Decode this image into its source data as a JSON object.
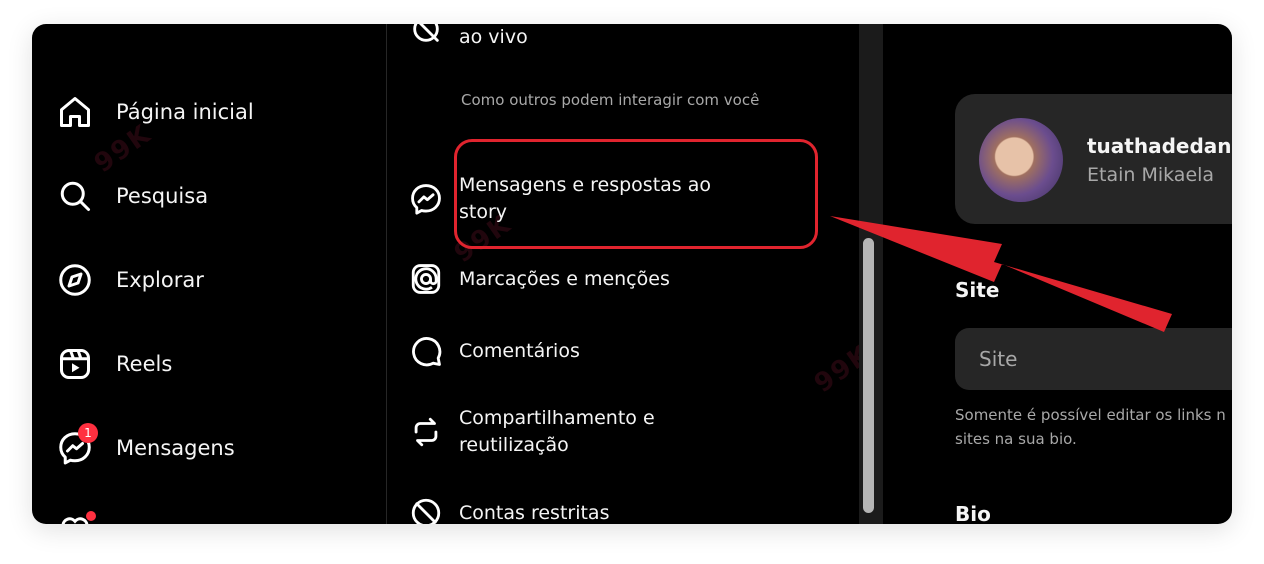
{
  "sidebar": {
    "items": [
      {
        "label": "Página inicial",
        "icon": "home-icon"
      },
      {
        "label": "Pesquisa",
        "icon": "search-icon"
      },
      {
        "label": "Explorar",
        "icon": "compass-icon"
      },
      {
        "label": "Reels",
        "icon": "reels-icon"
      },
      {
        "label": "Mensagens",
        "icon": "messenger-icon",
        "badge": "1"
      }
    ]
  },
  "settings": {
    "top_item": "ao vivo",
    "section_label": "Como outros podem interagir com você",
    "items": [
      {
        "label": "Mensagens e respostas ao story",
        "icon": "messenger-icon",
        "highlighted": true
      },
      {
        "label": "Marcações e menções",
        "icon": "at-icon"
      },
      {
        "label": "Comentários",
        "icon": "comment-icon"
      },
      {
        "label": "Compartilhamento e reutilização",
        "icon": "repost-icon"
      },
      {
        "label": "Contas restritas",
        "icon": "restricted-icon"
      }
    ]
  },
  "profile": {
    "username": "tuathadedan",
    "full_name": "Etain Mikaela"
  },
  "form": {
    "site_label": "Site",
    "site_placeholder": "Site",
    "site_helper": "Somente é possível editar os links n sites na sua bio.",
    "bio_label": "Bio"
  },
  "colors": {
    "background": "#000000",
    "highlight": "#e0242e",
    "badge": "#ff3040",
    "card": "#262626"
  }
}
